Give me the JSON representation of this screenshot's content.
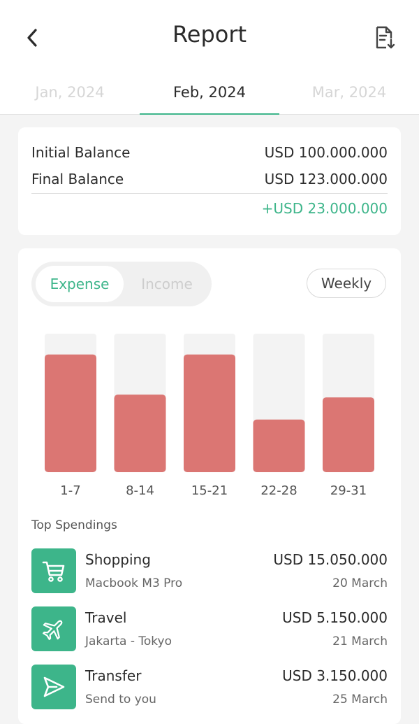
{
  "header": {
    "title": "Report",
    "back_icon": "chevron-left-icon",
    "export_icon": "document-download-icon"
  },
  "months": [
    {
      "label": "Jan, 2024",
      "active": false
    },
    {
      "label": "Feb, 2024",
      "active": true
    },
    {
      "label": "Mar, 2024",
      "active": false
    }
  ],
  "balance": {
    "initial_label": "Initial Balance",
    "initial_value": "USD 100.000.000",
    "final_label": "Final Balance",
    "final_value": "USD 123.000.000",
    "difference": "+USD 23.000.000"
  },
  "toggle": {
    "expense_label": "Expense",
    "income_label": "Income",
    "selected": "Expense",
    "period_label": "Weekly"
  },
  "colors": {
    "accent": "#3db58a",
    "bar": "#db7673",
    "bar_track": "#f3f3f3"
  },
  "chart_data": {
    "type": "bar",
    "categories": [
      "1-7",
      "8-14",
      "15-21",
      "22-28",
      "29-31"
    ],
    "values": [
      85,
      56,
      85,
      38,
      54
    ],
    "ylim": [
      0,
      100
    ],
    "grid": false
  },
  "top_spendings": {
    "label": "Top Spendings",
    "items": [
      {
        "name": "Shopping",
        "desc": "Macbook M3 Pro",
        "amount": "USD 15.050.000",
        "date": "20 March",
        "icon": "cart-icon"
      },
      {
        "name": "Travel",
        "desc": "Jakarta - Tokyo",
        "amount": "USD 5.150.000",
        "date": "21 March",
        "icon": "airplane-icon"
      },
      {
        "name": "Transfer",
        "desc": "Send to you",
        "amount": "USD 3.150.000",
        "date": "25 March",
        "icon": "send-icon"
      }
    ]
  }
}
